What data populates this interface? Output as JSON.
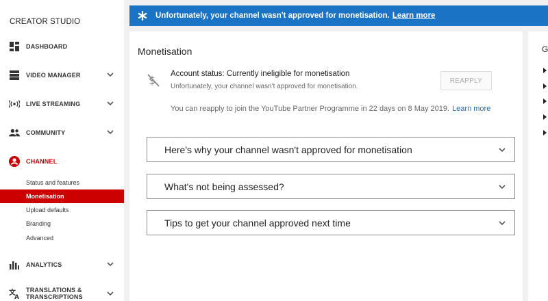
{
  "sidebar": {
    "brand": "CREATOR STUDIO",
    "items": [
      {
        "label": "DASHBOARD",
        "icon": "dashboard-icon"
      },
      {
        "label": "VIDEO MANAGER",
        "icon": "video-manager-icon"
      },
      {
        "label": "LIVE STREAMING",
        "icon": "live-streaming-icon"
      },
      {
        "label": "COMMUNITY",
        "icon": "community-icon"
      },
      {
        "label": "CHANNEL",
        "icon": "channel-icon"
      },
      {
        "label": "ANALYTICS",
        "icon": "analytics-icon"
      },
      {
        "label": "TRANSLATIONS &",
        "label2": "TRANSCRIPTIONS",
        "icon": "translate-icon"
      }
    ],
    "channel_sub": [
      "Status and features",
      "Monetisation",
      "Upload defaults",
      "Branding",
      "Advanced"
    ]
  },
  "banner": {
    "message": "Unfortunately, your channel wasn't approved for monetisation.",
    "link": "Learn more",
    "color": "#1b73c6"
  },
  "main": {
    "title": "Monetisation",
    "status_title": "Account status: Currently ineligible for monetisation",
    "status_sub": "Unfortunately, your channel wasn't approved for monetisation.",
    "reapply_button": "REAPPLY",
    "reapply_note": "You can reapply to join the YouTube Partner Programme in 22 days on 8 May 2019.",
    "reapply_link": "Learn more",
    "accordions": [
      "Here's why your channel wasn't approved for monetisation",
      "What's not being assessed?",
      "Tips to get your channel approved next time"
    ]
  },
  "right_panel": {
    "heading": "G"
  },
  "colors": {
    "accent_red": "#cc0000",
    "link_blue": "#1a6fc2"
  }
}
